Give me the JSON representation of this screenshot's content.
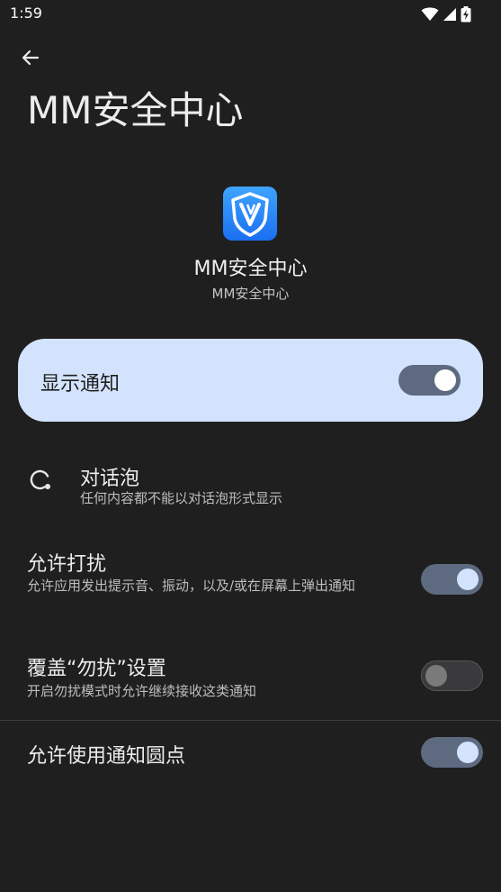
{
  "status_bar": {
    "time": "1:59",
    "icons": [
      "wifi-icon",
      "cell-signal-icon",
      "battery-charging-icon"
    ]
  },
  "header": {
    "back_icon": "arrow-back-icon",
    "title": "MM安全中心"
  },
  "app": {
    "icon": "mm-security-shield-icon",
    "name": "MM安全中心",
    "package_label": "MM安全中心"
  },
  "main_toggle": {
    "label": "显示通知",
    "state": "on"
  },
  "settings": [
    {
      "id": "bubbles",
      "icon": "bubble-icon",
      "title": "对话泡",
      "subtitle": "任何内容都不能以对话泡形式显示"
    },
    {
      "id": "allow-interruptions",
      "title": "允许打扰",
      "subtitle": "允许应用发出提示音、振动，以及/或在屏幕上弹出通知",
      "toggle": "on"
    },
    {
      "id": "override-dnd",
      "title": "覆盖“勿扰”设置",
      "subtitle": "开启勿扰模式时允许继续接收这类通知",
      "toggle": "off"
    },
    {
      "id": "notification-dot",
      "title": "允许使用通知圆点",
      "toggle": "on"
    }
  ],
  "colors": {
    "background": "#1f1f1f",
    "card": "#d3e3fd",
    "toggle_on_track": "#5e6a80",
    "toggle_on_knob": "#d3e3fd"
  }
}
